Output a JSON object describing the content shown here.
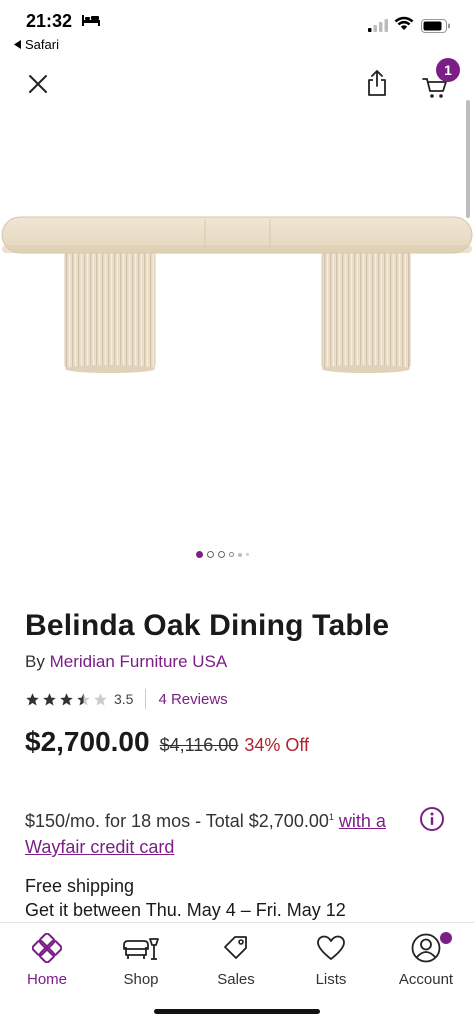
{
  "status_bar": {
    "time": "21:32",
    "back_app": "Safari",
    "icons": [
      "bed-icon",
      "signal-icon",
      "wifi-icon",
      "battery-icon"
    ]
  },
  "top_bar": {
    "icons": [
      "close-icon",
      "share-icon",
      "cart-icon"
    ],
    "cart_count": "1"
  },
  "gallery": {
    "dots_total": 6,
    "active_index": 0
  },
  "product": {
    "title": "Belinda Oak Dining Table",
    "by_label": "By",
    "brand": "Meridian Furniture USA",
    "rating": 3.5,
    "rating_text": "3.5",
    "reviews_text": "4 Reviews",
    "price": "$2,700.00",
    "original_price": "$4,116.00",
    "discount": "34% Off"
  },
  "financing": {
    "text": "$150/mo. for 18 mos - Total $2,700.00",
    "superscript": "1",
    "link": "with a Wayfair credit card"
  },
  "shipping": {
    "line1": "Free shipping",
    "line2": "Get it between Thu. May 4 – Fri. May 12"
  },
  "bottom_nav": {
    "items": [
      {
        "label": "Home",
        "icon": "home-icon",
        "active": true
      },
      {
        "label": "Shop",
        "icon": "shop-icon",
        "active": false
      },
      {
        "label": "Sales",
        "icon": "sales-tag-icon",
        "active": false
      },
      {
        "label": "Lists",
        "icon": "heart-icon",
        "active": false
      },
      {
        "label": "Account",
        "icon": "account-icon",
        "active": false
      }
    ]
  },
  "colors": {
    "brand_purple": "#7b1f87",
    "discount_red": "#b2222b",
    "table_wood": "#e8dcc6"
  }
}
